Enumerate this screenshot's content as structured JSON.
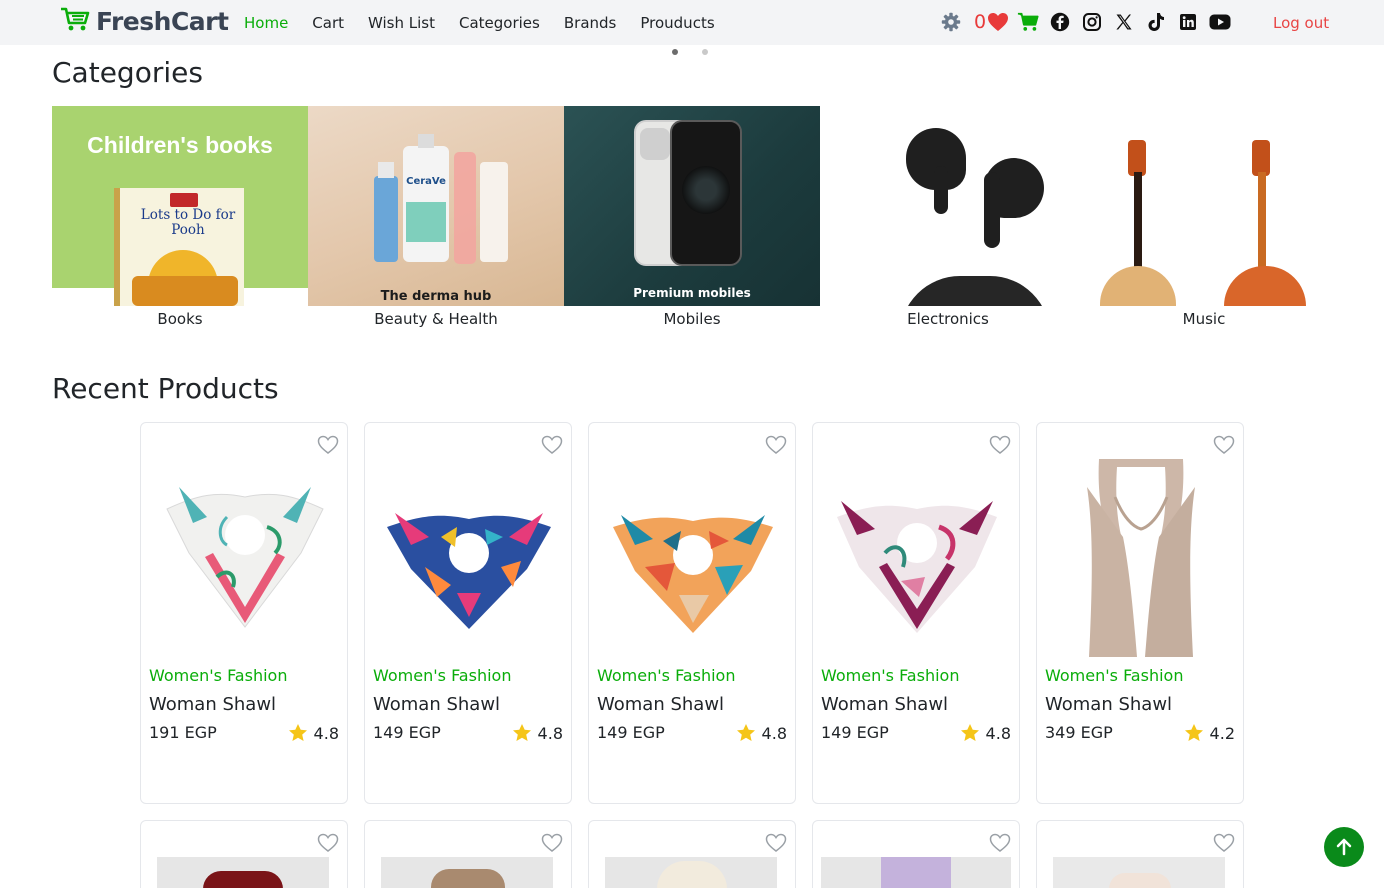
{
  "brand": {
    "name": "FreshCart"
  },
  "nav": {
    "links": [
      {
        "label": "Home",
        "active": true
      },
      {
        "label": "Cart",
        "active": false
      },
      {
        "label": "Wish List",
        "active": false
      },
      {
        "label": "Categories",
        "active": false
      },
      {
        "label": "Brands",
        "active": false
      },
      {
        "label": "Prouducts",
        "active": false
      }
    ],
    "wishlist_count": "0",
    "logout_label": "Log out",
    "icons": [
      "gear-icon",
      "heart-icon",
      "cart-icon",
      "facebook-icon",
      "instagram-icon",
      "x-icon",
      "tiktok-icon",
      "linkedin-icon",
      "youtube-icon"
    ]
  },
  "slider": {
    "dot_count": 2,
    "active_index": 0
  },
  "categories": {
    "title": "Categories",
    "items": [
      {
        "label": "Books",
        "banner_text": "Children's books",
        "cover_text": "Lots to Do for Pooh"
      },
      {
        "label": "Beauty & Health",
        "banner_text": "The derma hub",
        "cover_text": "CeraVe"
      },
      {
        "label": "Mobiles",
        "banner_text": "Premium mobiles",
        "cover_text": ""
      },
      {
        "label": "Electronics",
        "banner_text": "",
        "cover_text": ""
      },
      {
        "label": "Music",
        "banner_text": "",
        "cover_text": ""
      }
    ]
  },
  "recent": {
    "title": "Recent Products",
    "products": [
      {
        "category": "Women's Fashion",
        "title": "Woman Shawl",
        "price": "191 EGP",
        "rating": "4.8"
      },
      {
        "category": "Women's Fashion",
        "title": "Woman Shawl",
        "price": "149 EGP",
        "rating": "4.8"
      },
      {
        "category": "Women's Fashion",
        "title": "Woman Shawl",
        "price": "149 EGP",
        "rating": "4.8"
      },
      {
        "category": "Women's Fashion",
        "title": "Woman Shawl",
        "price": "149 EGP",
        "rating": "4.8"
      },
      {
        "category": "Women's Fashion",
        "title": "Woman Shawl",
        "price": "349 EGP",
        "rating": "4.2"
      }
    ]
  },
  "colors": {
    "accent": "#0aad0a",
    "logout": "#e84545",
    "nav_bg": "#f3f4f6",
    "star": "#f5c518",
    "back_to_top": "#0a8a1a"
  }
}
